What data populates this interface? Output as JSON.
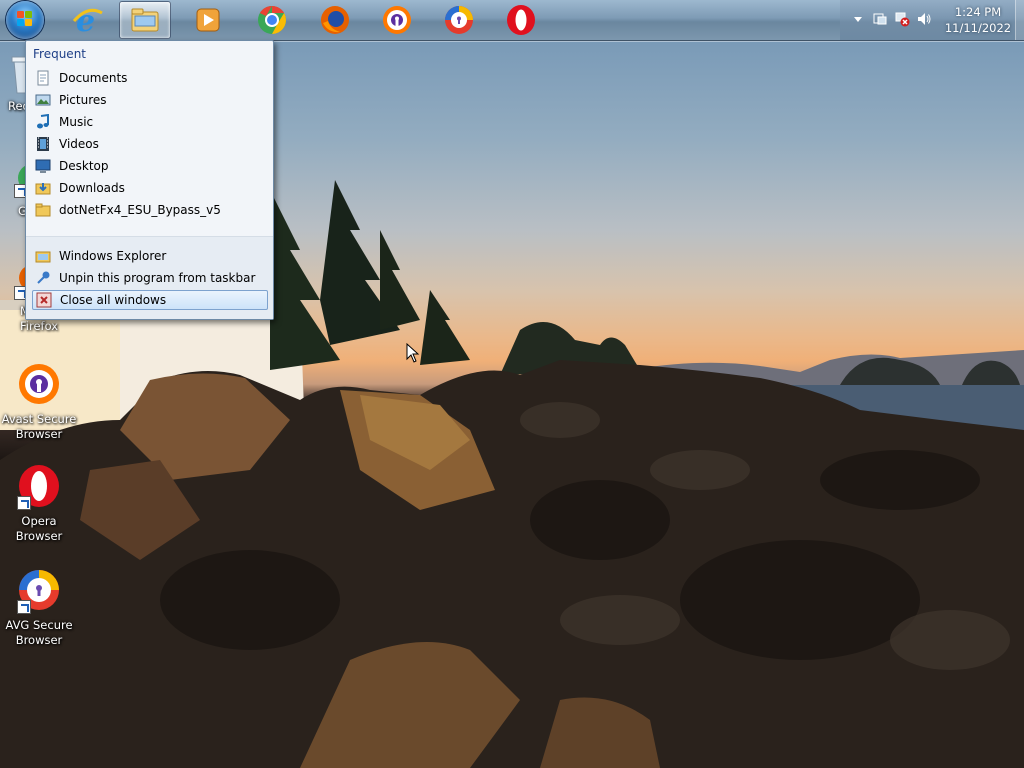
{
  "taskbar": {
    "pinned": [
      {
        "name": "Internet Explorer",
        "icon": "internet-explorer-icon"
      },
      {
        "name": "Windows Explorer",
        "icon": "windows-explorer-icon",
        "active": true
      },
      {
        "name": "Windows Media Player",
        "icon": "media-player-icon"
      },
      {
        "name": "Google Chrome",
        "icon": "chrome-icon"
      },
      {
        "name": "Mozilla Firefox",
        "icon": "firefox-icon"
      },
      {
        "name": "Avast Secure Browser",
        "icon": "avast-browser-icon"
      },
      {
        "name": "AVG Secure Browser",
        "icon": "avg-browser-icon"
      },
      {
        "name": "Opera Browser",
        "icon": "opera-icon"
      }
    ],
    "clock": {
      "time": "1:24 PM",
      "date": "11/11/2022"
    }
  },
  "desktop": {
    "icons": [
      {
        "label": "Rec",
        "icon": "recycle-bin-icon"
      },
      {
        "label": "G C",
        "icon": "chrome-icon"
      },
      {
        "label": "M Firefox",
        "icon": "firefox-icon"
      },
      {
        "label_line1": "Avast Secure",
        "label_line2": "Browser",
        "icon": "avast-browser-icon"
      },
      {
        "label_line1": "Opera",
        "label_line2": "Browser",
        "icon": "opera-icon"
      },
      {
        "label_line1": "AVG Secure",
        "label_line2": "Browser",
        "icon": "avg-browser-icon"
      }
    ]
  },
  "jumplist": {
    "header": "Frequent",
    "frequent": [
      {
        "label": "Documents",
        "icon": "documents-icon"
      },
      {
        "label": "Pictures",
        "icon": "pictures-icon"
      },
      {
        "label": "Music",
        "icon": "music-icon"
      },
      {
        "label": "Videos",
        "icon": "videos-icon"
      },
      {
        "label": "Desktop",
        "icon": "desktop-icon"
      },
      {
        "label": "Downloads",
        "icon": "downloads-icon"
      },
      {
        "label": "dotNetFx4_ESU_Bypass_v5",
        "icon": "folder-icon"
      }
    ],
    "tasks": [
      {
        "label": "Windows Explorer",
        "icon": "windows-explorer-icon"
      },
      {
        "label": "Unpin this program from taskbar",
        "icon": "unpin-icon"
      },
      {
        "label": "Close all windows",
        "icon": "close-window-icon",
        "highlighted": true
      }
    ]
  },
  "colors": {
    "taskbar": "#7e9bb5",
    "jumplist_bg": "#f2f5f9",
    "jumplist_header": "#1e3f87",
    "highlight": "#cde3f9"
  }
}
